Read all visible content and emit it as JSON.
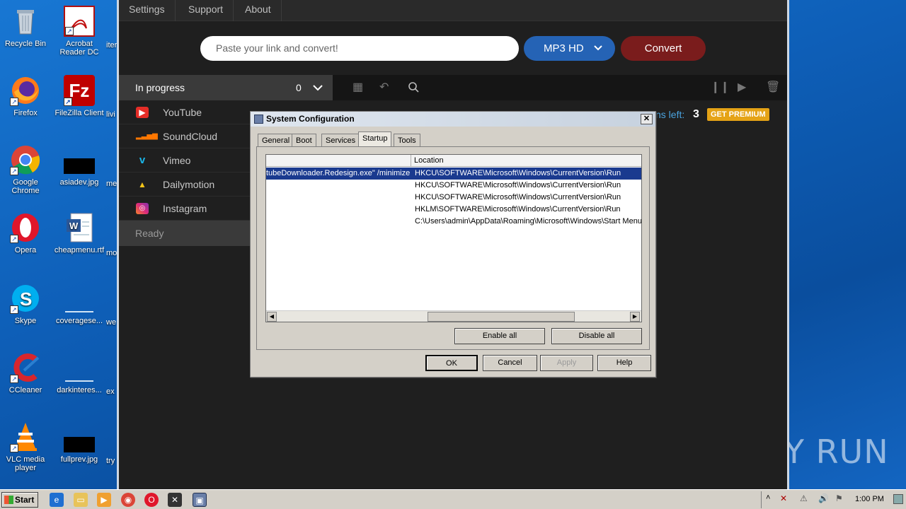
{
  "desktop": {
    "icons": [
      {
        "label": "Recycle Bin",
        "icon": "recycle-bin-icon"
      },
      {
        "label": "Acrobat Reader DC",
        "icon": "acrobat-icon"
      },
      {
        "label": "Firefox",
        "icon": "firefox-icon"
      },
      {
        "label": "FileZilla Client",
        "icon": "filezilla-icon"
      },
      {
        "label": "Google Chrome",
        "icon": "chrome-icon"
      },
      {
        "label": "asiadev.jpg",
        "icon": "image-file-icon"
      },
      {
        "label": "Opera",
        "icon": "opera-icon"
      },
      {
        "label": "cheapmenu.rtf",
        "icon": "word-doc-icon"
      },
      {
        "label": "Skype",
        "icon": "skype-icon"
      },
      {
        "label": "coveragese...",
        "icon": "blank-file-icon"
      },
      {
        "label": "CCleaner",
        "icon": "ccleaner-icon"
      },
      {
        "label": "darkinteres...",
        "icon": "blank-file-icon"
      },
      {
        "label": "VLC media player",
        "icon": "vlc-icon"
      },
      {
        "label": "fullprev.jpg",
        "icon": "image-file-icon"
      }
    ],
    "partial_labels": [
      "iter",
      "livi",
      "me",
      "mo",
      "we",
      "ex",
      "try"
    ],
    "watermark": "ANY RUN"
  },
  "app": {
    "menu": [
      "Settings",
      "Support",
      "About"
    ],
    "url_placeholder": "Paste your link and convert!",
    "format_label": "MP3 HD",
    "convert_label": "Convert",
    "in_progress_label": "In progress",
    "in_progress_count": "0",
    "sources": [
      {
        "label": "YouTube",
        "icon": "youtube-icon",
        "color": "#e52d27"
      },
      {
        "label": "SoundCloud",
        "icon": "soundcloud-icon",
        "color": "#ff7700"
      },
      {
        "label": "Vimeo",
        "icon": "vimeo-icon",
        "color": "#1ab7ea"
      },
      {
        "label": "Dailymotion",
        "icon": "dailymotion-icon",
        "color": "#f5c518"
      },
      {
        "label": "Instagram",
        "icon": "instagram-icon",
        "color": "#c13584"
      }
    ],
    "ready_label": "Ready",
    "conversions_left_label": "ns left:",
    "conversions_left_count": "3",
    "premium_label": "GET PREMIUM"
  },
  "dialog": {
    "title": "System Configuration",
    "tabs": [
      "General",
      "Boot",
      "Services",
      "Startup",
      "Tools"
    ],
    "active_tab": "Startup",
    "column_location": "Location",
    "rows": [
      {
        "command": "tubeDownloader.Redesign.exe\" /minimize",
        "location": "HKCU\\SOFTWARE\\Microsoft\\Windows\\CurrentVersion\\Run"
      },
      {
        "command": "",
        "location": "HKCU\\SOFTWARE\\Microsoft\\Windows\\CurrentVersion\\Run"
      },
      {
        "command": "",
        "location": "HKCU\\SOFTWARE\\Microsoft\\Windows\\CurrentVersion\\Run"
      },
      {
        "command": "",
        "location": "HKLM\\SOFTWARE\\Microsoft\\Windows\\CurrentVersion\\Run"
      },
      {
        "command": "",
        "location": "C:\\Users\\admin\\AppData\\Roaming\\Microsoft\\Windows\\Start Menu\\"
      }
    ],
    "enable_all": "Enable all",
    "disable_all": "Disable all",
    "ok": "OK",
    "cancel": "Cancel",
    "apply": "Apply",
    "help": "Help",
    "close_glyph": "✕"
  },
  "taskbar": {
    "start_label": "Start",
    "clock": "1:00 PM"
  }
}
